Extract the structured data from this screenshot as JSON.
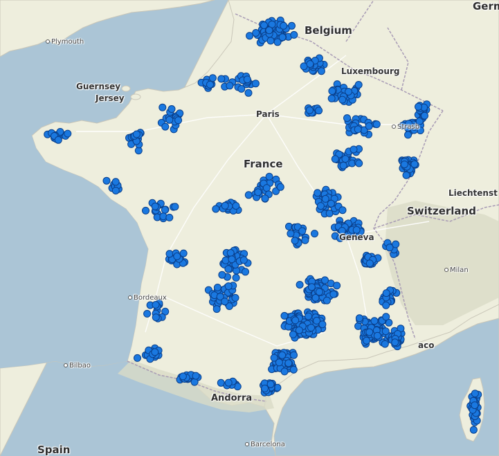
{
  "map": {
    "colors": {
      "sea": "#abc5d6",
      "land": "#eeeedd",
      "mountain": "#dadbc7",
      "border": "#a89bb5",
      "road": "#ffffff",
      "marker_fill": "#1a78e0",
      "marker_stroke": "#0a3f8a"
    },
    "labels": [
      {
        "id": "germany",
        "text": "Germ",
        "kind": "country"
      },
      {
        "id": "belgium",
        "text": "Belgium",
        "kind": "country"
      },
      {
        "id": "plymouth",
        "text": "Plymouth",
        "kind": "city"
      },
      {
        "id": "luxembourg",
        "text": "Luxembourg",
        "kind": "major"
      },
      {
        "id": "guernsey",
        "text": "Guernsey",
        "kind": "major"
      },
      {
        "id": "jersey",
        "text": "Jersey",
        "kind": "major"
      },
      {
        "id": "paris",
        "text": "Paris",
        "kind": "major"
      },
      {
        "id": "strasbourg",
        "text": "Strasb",
        "kind": "city"
      },
      {
        "id": "france",
        "text": "France",
        "kind": "country"
      },
      {
        "id": "liechtenstein",
        "text": "Liechtenst",
        "kind": "major"
      },
      {
        "id": "switzerland",
        "text": "Switzerland",
        "kind": "country"
      },
      {
        "id": "geneva",
        "text": "Geneva",
        "kind": "major"
      },
      {
        "id": "milan",
        "text": "Milan",
        "kind": "city"
      },
      {
        "id": "bordeaux",
        "text": "Bordeaux",
        "kind": "city"
      },
      {
        "id": "monaco",
        "text": "aco",
        "kind": "major"
      },
      {
        "id": "bilbao",
        "text": "Bilbao",
        "kind": "city"
      },
      {
        "id": "andorra",
        "text": "Andorra",
        "kind": "major"
      },
      {
        "id": "spain",
        "text": "Spain",
        "kind": "country"
      },
      {
        "id": "barcelona",
        "text": "Barcelona",
        "kind": "city"
      }
    ]
  }
}
